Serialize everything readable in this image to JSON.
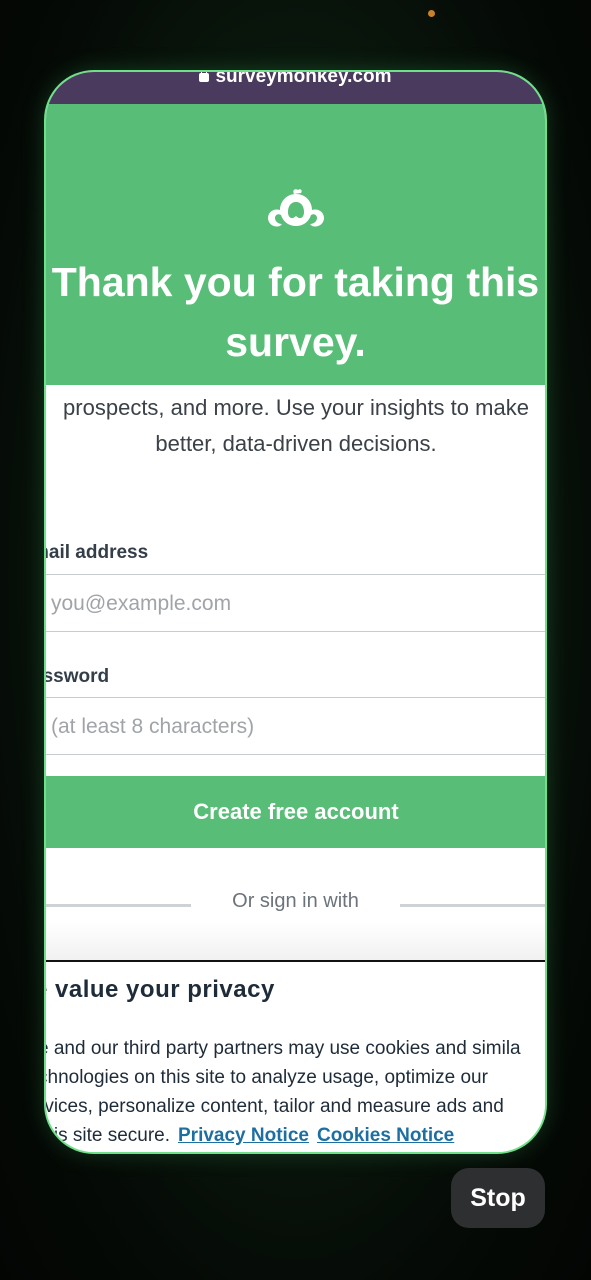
{
  "browser": {
    "url": "surveymonkey.com"
  },
  "hero": {
    "title_line1": "Thank you for taking this",
    "title_line2": "survey."
  },
  "body": {
    "line1": "prospects, and more. Use your insights to make",
    "line2": "better, data-driven decisions."
  },
  "form": {
    "email_label": "mail address",
    "email_placeholder": "you@example.com",
    "password_label": "assword",
    "password_placeholder": "(at least 8 characters)",
    "submit_label": "Create free account",
    "divider_text": "Or sign in with"
  },
  "privacy": {
    "title": "e value your privacy",
    "line1": "e and our third party partners may use cookies and simila",
    "line2": "chnologies on this site to analyze usage, optimize our",
    "line3": "rvices, personalize content, tailor and measure ads and",
    "line4": "this site secure.",
    "privacy_link": "Privacy Notice",
    "cookies_link": "Cookies Notice"
  },
  "controls": {
    "stop_label": "Stop"
  },
  "colors": {
    "brand_green": "#58bd77",
    "url_bar": "#4a3a5e",
    "link": "#1e6fa1"
  }
}
